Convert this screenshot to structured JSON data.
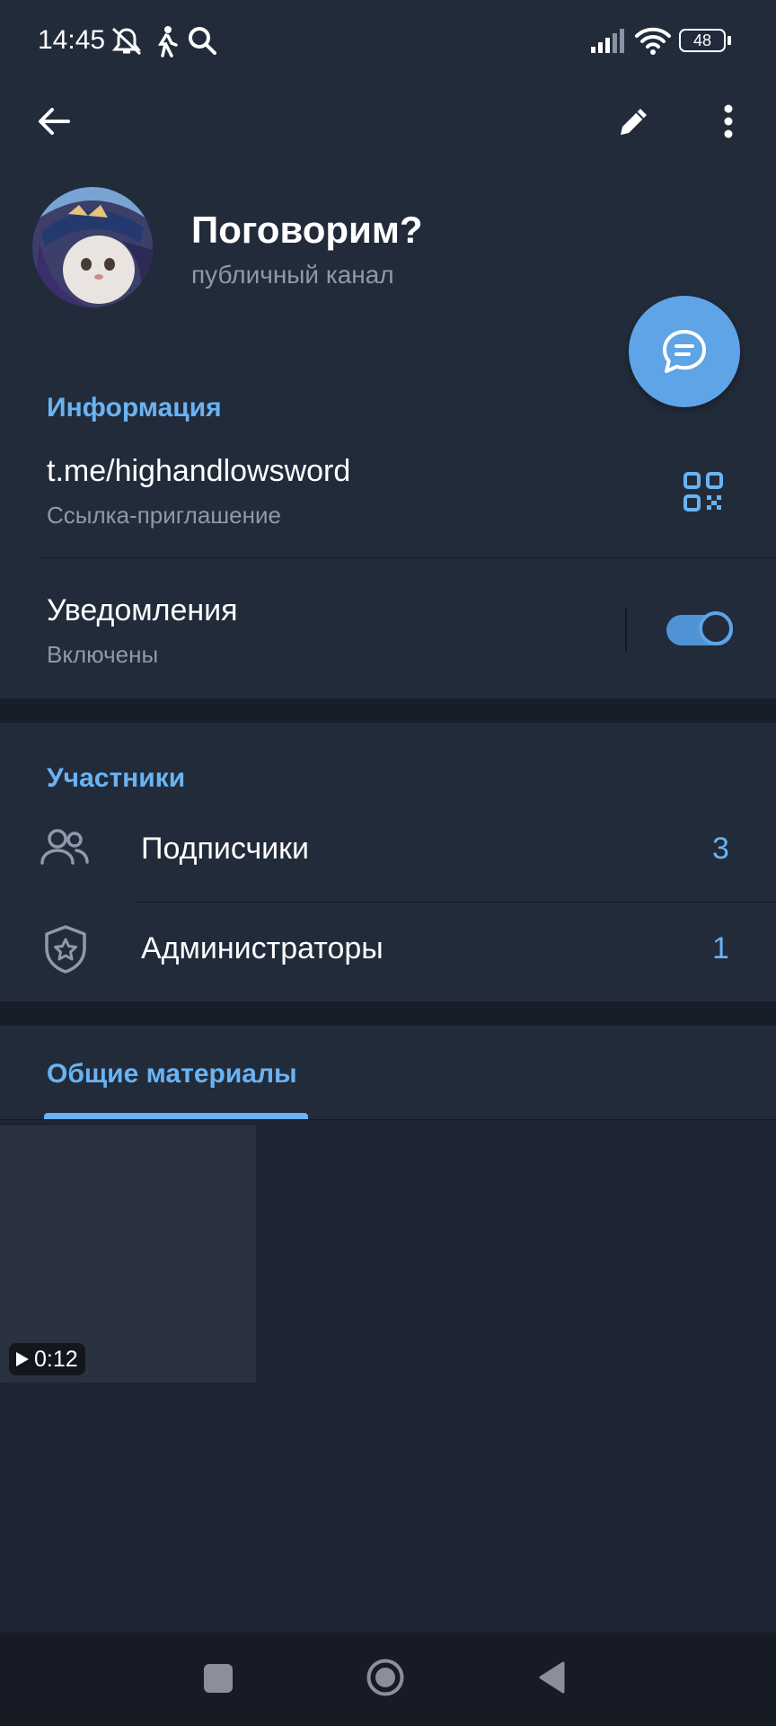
{
  "status_bar": {
    "time": "14:45",
    "battery": "48",
    "icons": [
      "mute-bell-icon",
      "walk-icon",
      "search-icon",
      "signal-icon",
      "wifi-icon",
      "battery-icon"
    ]
  },
  "header": {
    "back_icon": "arrow-left-icon",
    "edit_icon": "pencil-icon",
    "more_icon": "more-vertical-icon",
    "channel_name": "Поговорим?",
    "channel_type": "публичный канал",
    "fab_icon": "chat-bubble-icon"
  },
  "info": {
    "title": "Информация",
    "link": "t.me/highandlowsword",
    "link_caption": "Ссылка-приглашение",
    "notifications_label": "Уведомления",
    "notifications_state": "Включены",
    "notifications_on": true
  },
  "members": {
    "title": "Участники",
    "items": [
      {
        "label": "Подписчики",
        "count": "3",
        "icon": "people-icon"
      },
      {
        "label": "Администраторы",
        "count": "1",
        "icon": "shield-star-icon"
      }
    ]
  },
  "shared": {
    "tab_label": "Общие материалы",
    "media": [
      {
        "duration": "0:12",
        "type": "video"
      }
    ]
  },
  "colors": {
    "accent": "#6ab3f3",
    "background": "#1d2433",
    "surface": "#222b3a",
    "fab": "#5ea4e6"
  }
}
